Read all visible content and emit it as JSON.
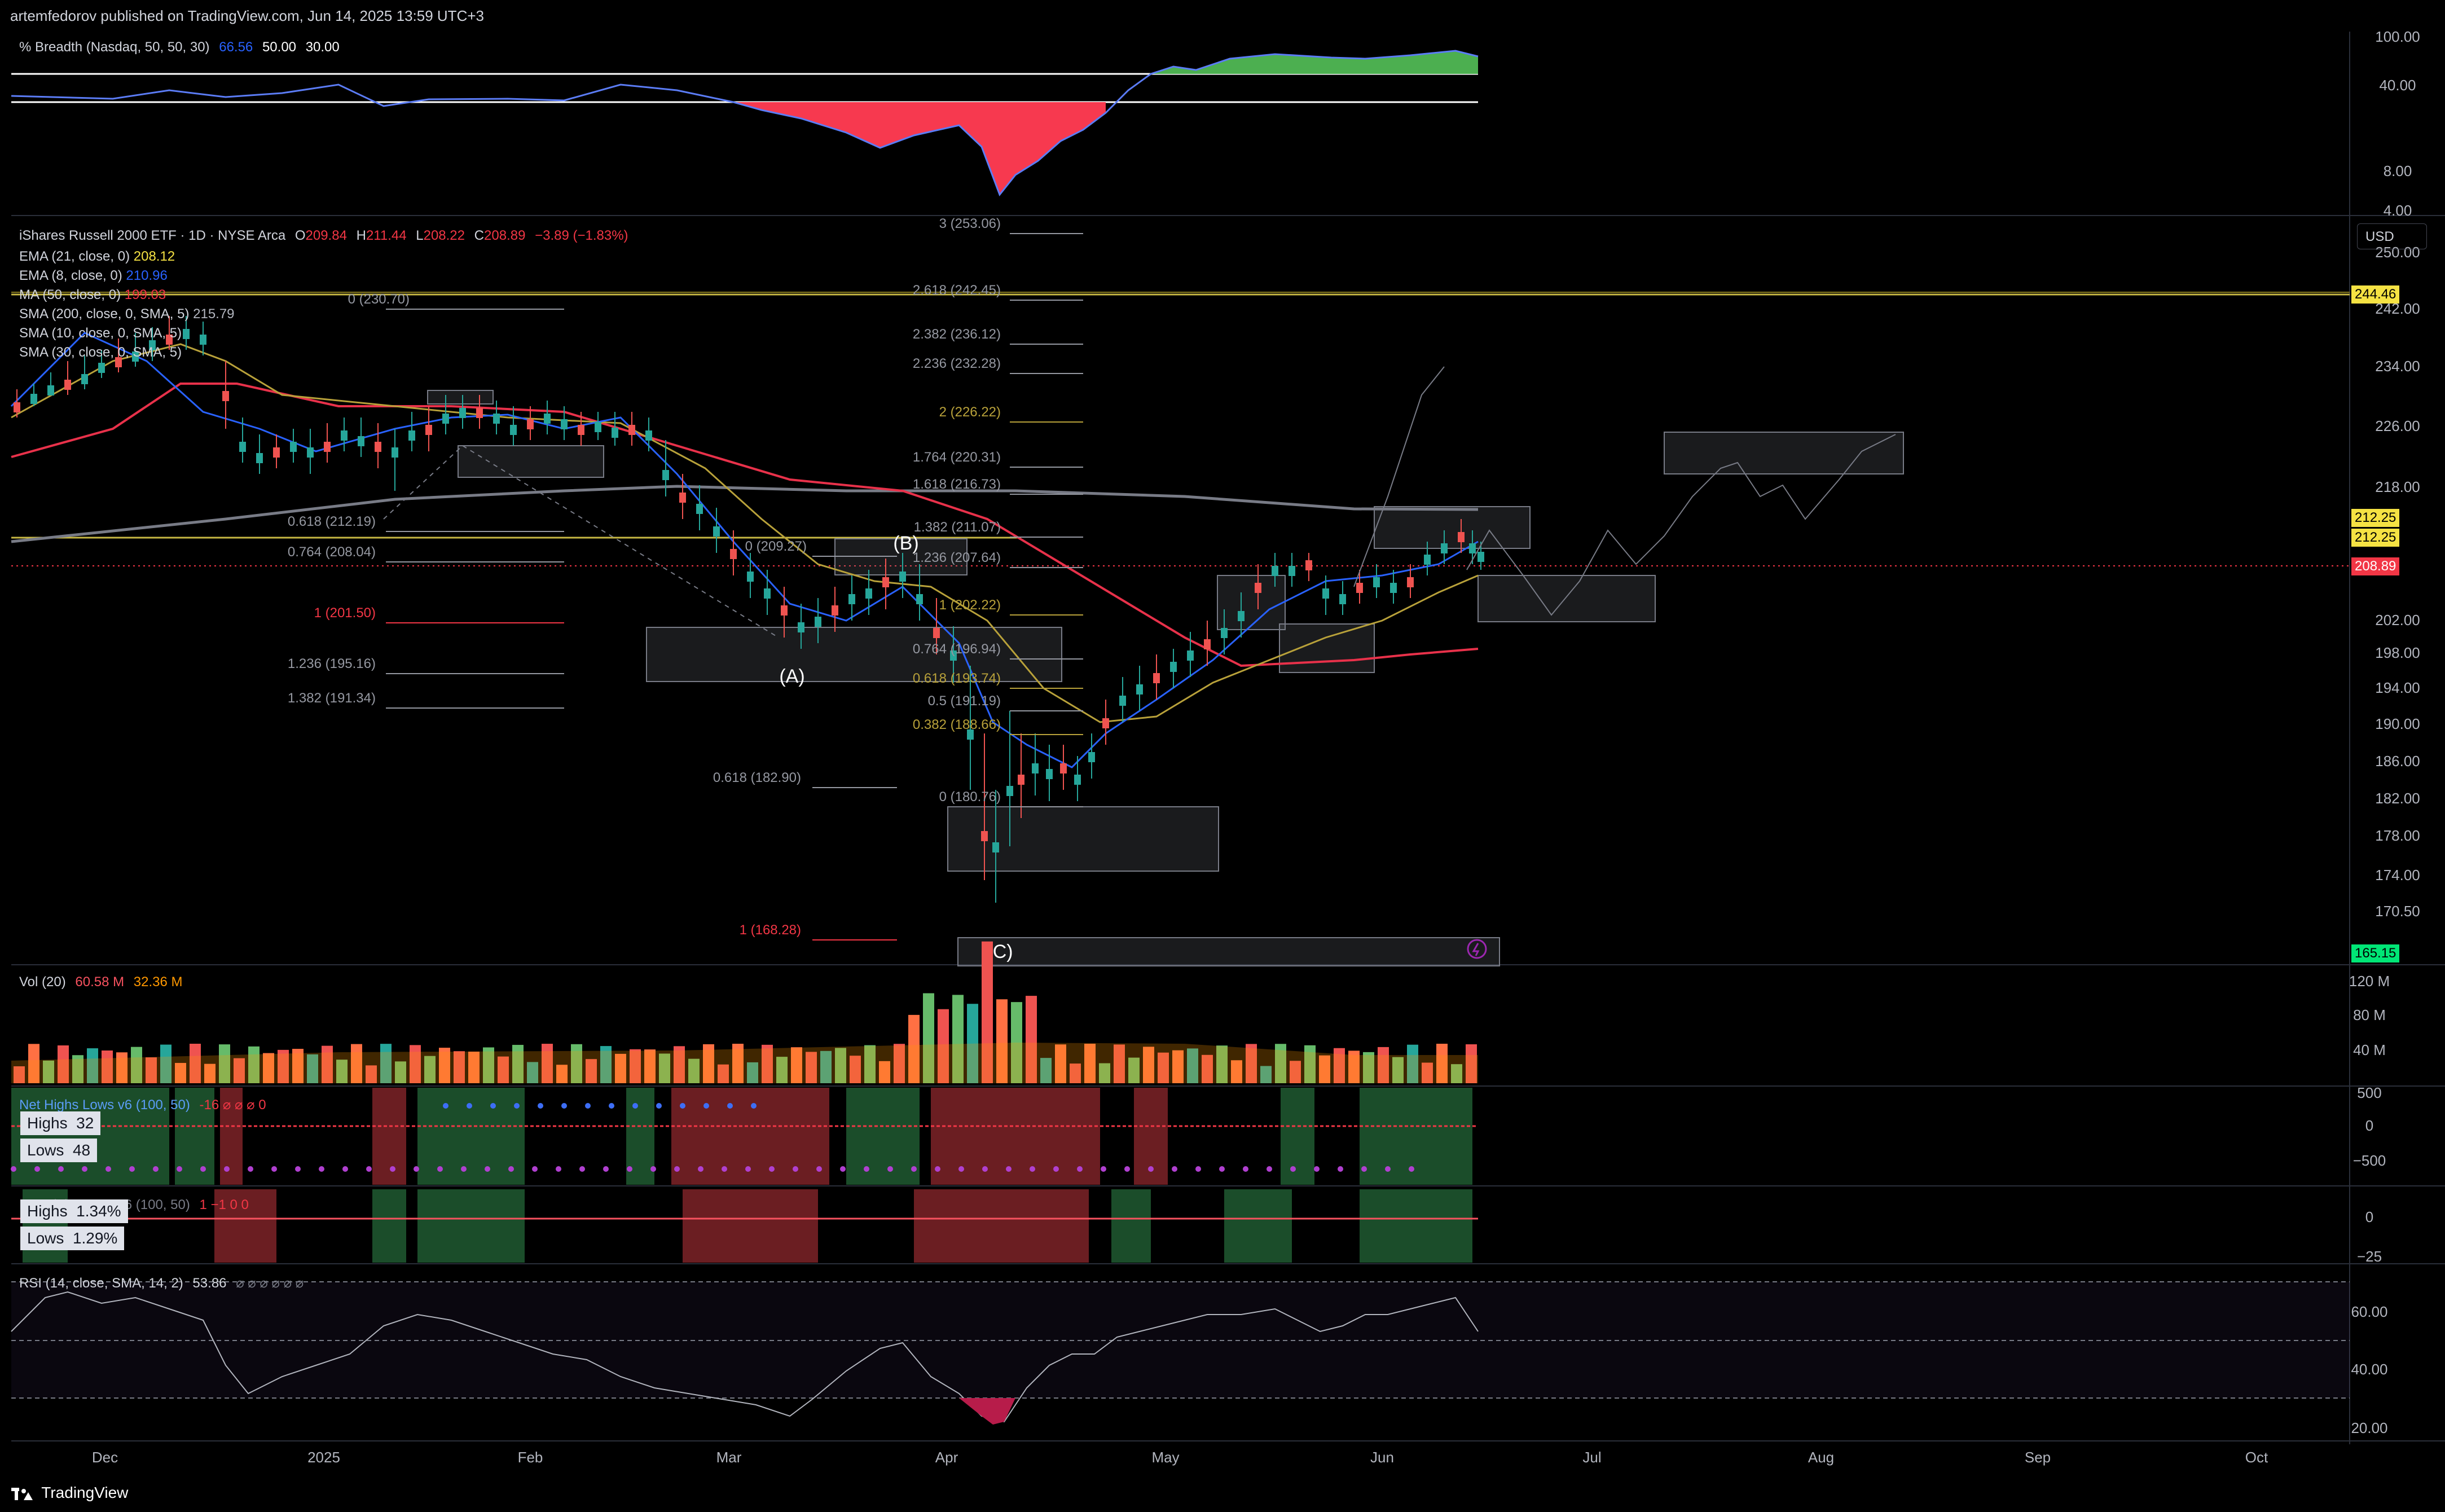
{
  "header": {
    "published": "artemfedorov published on TradingView.com, Jun 14, 2025 13:59 UTC+3"
  },
  "breadth": {
    "title": "% Breadth (Nasdaq, 50, 50, 30)",
    "value": "66.56",
    "upper": "50.00",
    "lower": "30.00",
    "ticks": [
      "100.00",
      "40.00",
      "8.00",
      "4.00"
    ]
  },
  "main": {
    "symbol": "iShares Russell 2000 ETF · 1D · NYSE Arca",
    "o_label": "O",
    "o": "209.84",
    "h_label": "H",
    "h": "211.44",
    "l_label": "L",
    "l": "208.22",
    "c_label": "C",
    "c": "208.89",
    "change": "−3.89 (−1.83%)",
    "indicators": [
      {
        "label": "EMA (21, close, 0)",
        "value": "208.12",
        "color": "#f5e243"
      },
      {
        "label": "EMA (8, close, 0)",
        "value": "210.96",
        "color": "#2962ff"
      },
      {
        "label": "MA (50, close, 0)",
        "value": "199.03",
        "color": "#f23645"
      },
      {
        "label": "SMA (200, close, 0, SMA, 5)",
        "value": "215.79",
        "color": "#b2b5be"
      },
      {
        "label": "SMA (10, close, 0, SMA, 5)",
        "value": "",
        "color": "#b2b5be"
      },
      {
        "label": "SMA (30, close, 0, SMA, 5)",
        "value": "",
        "color": "#b2b5be"
      }
    ],
    "currency": "USD",
    "price_ticks": [
      "250.00",
      "242.00",
      "234.00",
      "226.00",
      "218.00",
      "202.00",
      "198.00",
      "194.00",
      "190.00",
      "186.00",
      "182.00",
      "178.00",
      "174.00",
      "170.50"
    ],
    "price_tags": [
      {
        "text": "244.46",
        "bg": "#f5e243",
        "fg": "#000"
      },
      {
        "text": "212.25",
        "bg": "#f5e243",
        "fg": "#000"
      },
      {
        "text": "212.25",
        "bg": "#f5e243",
        "fg": "#000"
      },
      {
        "text": "208.89",
        "bg": "#f23645",
        "fg": "#fff"
      },
      {
        "text": "165.15",
        "bg": "#00e676",
        "fg": "#000"
      }
    ],
    "fib_left": [
      {
        "text": "0 (230.70)",
        "color": "#9598a1"
      },
      {
        "text": "0.618 (212.19)",
        "color": "#9598a1"
      },
      {
        "text": "0.764 (208.04)",
        "color": "#9598a1"
      },
      {
        "text": "1 (201.50)",
        "color": "#f23645"
      },
      {
        "text": "1.236 (195.16)",
        "color": "#9598a1"
      },
      {
        "text": "1.382 (191.34)",
        "color": "#9598a1"
      }
    ],
    "fib_mid": [
      {
        "text": "0 (209.27)",
        "color": "#9598a1"
      },
      {
        "text": "0.618 (182.90)",
        "color": "#9598a1"
      },
      {
        "text": "1 (168.28)",
        "color": "#f23645"
      }
    ],
    "fib_right": [
      {
        "text": "3 (253.06)",
        "color": "#9598a1"
      },
      {
        "text": "2.618 (242.45)",
        "color": "#9598a1"
      },
      {
        "text": "2.382 (236.12)",
        "color": "#9598a1"
      },
      {
        "text": "2.236 (232.28)",
        "color": "#9598a1"
      },
      {
        "text": "2 (226.22)",
        "color": "#b8a13a"
      },
      {
        "text": "1.764 (220.31)",
        "color": "#9598a1"
      },
      {
        "text": "1.618 (216.73)",
        "color": "#9598a1"
      },
      {
        "text": "1.382 (211.07)",
        "color": "#9598a1"
      },
      {
        "text": "1.236 (207.64)",
        "color": "#9598a1"
      },
      {
        "text": "1 (202.22)",
        "color": "#b8a13a"
      },
      {
        "text": "0.764 (196.94)",
        "color": "#9598a1"
      },
      {
        "text": "0.618 (193.74)",
        "color": "#b8a13a"
      },
      {
        "text": "0.5 (191.19)",
        "color": "#9598a1"
      },
      {
        "text": "0.382 (188.66)",
        "color": "#b8a13a"
      },
      {
        "text": "0 (180.76)",
        "color": "#9598a1"
      }
    ],
    "wave_labels": [
      "(A)",
      "(B)",
      "(C)"
    ]
  },
  "volume": {
    "title": "Vol (20)",
    "v1": "60.58 M",
    "v2": "32.36 M",
    "ticks": [
      "120 M",
      "80 M",
      "40 M"
    ]
  },
  "net_highs_lows": {
    "title": "Net Highs Lows v6 (100, 50)",
    "values": "-16  ⌀  ⌀  ⌀  0",
    "highs_label": "Highs",
    "highs": "32",
    "lows_label": "Lows",
    "lows": "48",
    "ticks": [
      "500",
      "0",
      "−500"
    ]
  },
  "net_highs_lows_pct": {
    "title": "Net Highs Lows v6 (100, 50)",
    "values": "1  −1  0  0",
    "highs_label": "Highs",
    "highs": "1.34%",
    "lows_label": "Lows",
    "lows": "1.29%",
    "ticks": [
      "0",
      "−25"
    ]
  },
  "rsi": {
    "title": "RSI (14, close, SMA, 14, 2)",
    "value": "53.86",
    "extra": "⌀ ⌀ ⌀ ⌀ ⌀ ⌀",
    "ticks": [
      "60.00",
      "40.00",
      "20.00"
    ]
  },
  "time_axis": [
    "Dec",
    "2025",
    "Feb",
    "Mar",
    "Apr",
    "May",
    "Jun",
    "Jul",
    "Aug",
    "Sep",
    "Oct"
  ],
  "branding": {
    "name": "TradingView"
  }
}
